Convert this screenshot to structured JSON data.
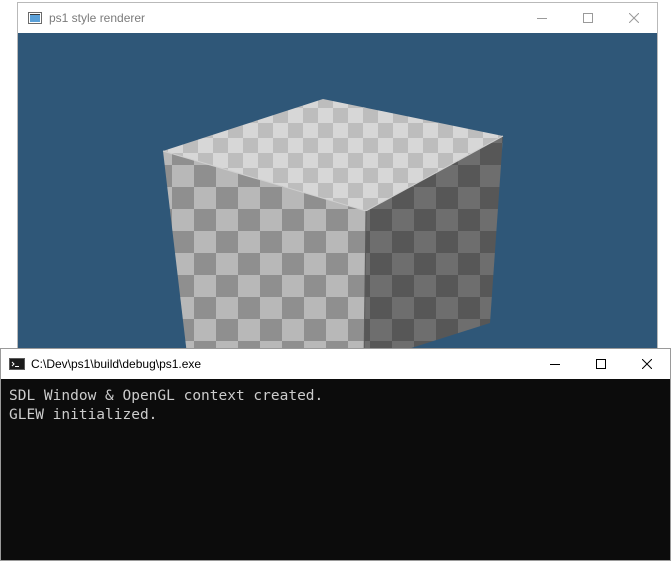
{
  "render_window": {
    "title": "ps1 style renderer",
    "icon": "app-window-icon",
    "controls": {
      "minimize": "minimize-icon",
      "maximize": "maximize-icon",
      "close": "close-icon"
    },
    "background_color": "#2f5778",
    "scene": {
      "object": "checkerboard-cube",
      "light_color": "#d9d9d9",
      "dark_color": "#a8a8a8"
    }
  },
  "console_window": {
    "title": "C:\\Dev\\ps1\\build\\debug\\ps1.exe",
    "icon": "console-icon",
    "controls": {
      "minimize": "minimize-icon",
      "maximize": "maximize-icon",
      "close": "close-icon"
    },
    "background_color": "#0c0c0c",
    "text_color": "#cccccc",
    "lines": [
      "SDL Window & OpenGL context created.",
      "GLEW initialized."
    ]
  }
}
